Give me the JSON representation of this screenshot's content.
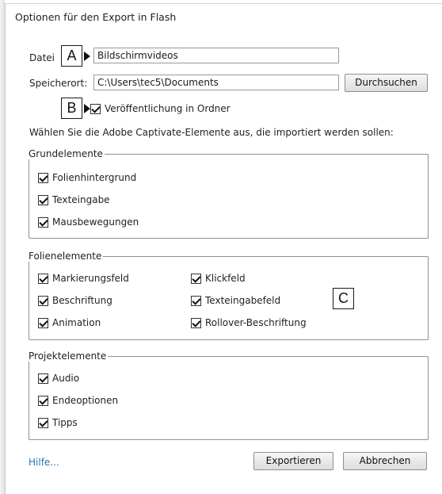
{
  "dialog": {
    "title": "Optionen für den Export in Flash"
  },
  "file": {
    "label": "Datei",
    "value": "Bildschirmvideos"
  },
  "location": {
    "label": "Speicherort:",
    "value": "C:\\Users\\tec5\\Documents",
    "browse_label": "Durchsuchen"
  },
  "publish_folder": {
    "label": "Veröffentlichung in Ordner",
    "checked": true
  },
  "instruction": "Wählen Sie die Adobe Captivate-Elemente aus, die importiert werden sollen:",
  "groups": {
    "basic": {
      "title": "Grundelemente",
      "items": [
        "Folienhintergrund",
        "Texteingabe",
        "Mausbewegungen"
      ]
    },
    "slide": {
      "title": "Folienelemente",
      "left": [
        "Markierungsfeld",
        "Beschriftung",
        "Animation"
      ],
      "right": [
        "Klickfeld",
        "Texteingabefeld",
        "Rollover-Beschriftung"
      ]
    },
    "project": {
      "title": "Projektelemente",
      "items": [
        "Audio",
        "Endeoptionen",
        "Tipps"
      ]
    }
  },
  "callouts": {
    "a": "A",
    "b": "B",
    "c": "C"
  },
  "footer": {
    "help": "Hilfe...",
    "export": "Exportieren",
    "cancel": "Abbrechen"
  }
}
